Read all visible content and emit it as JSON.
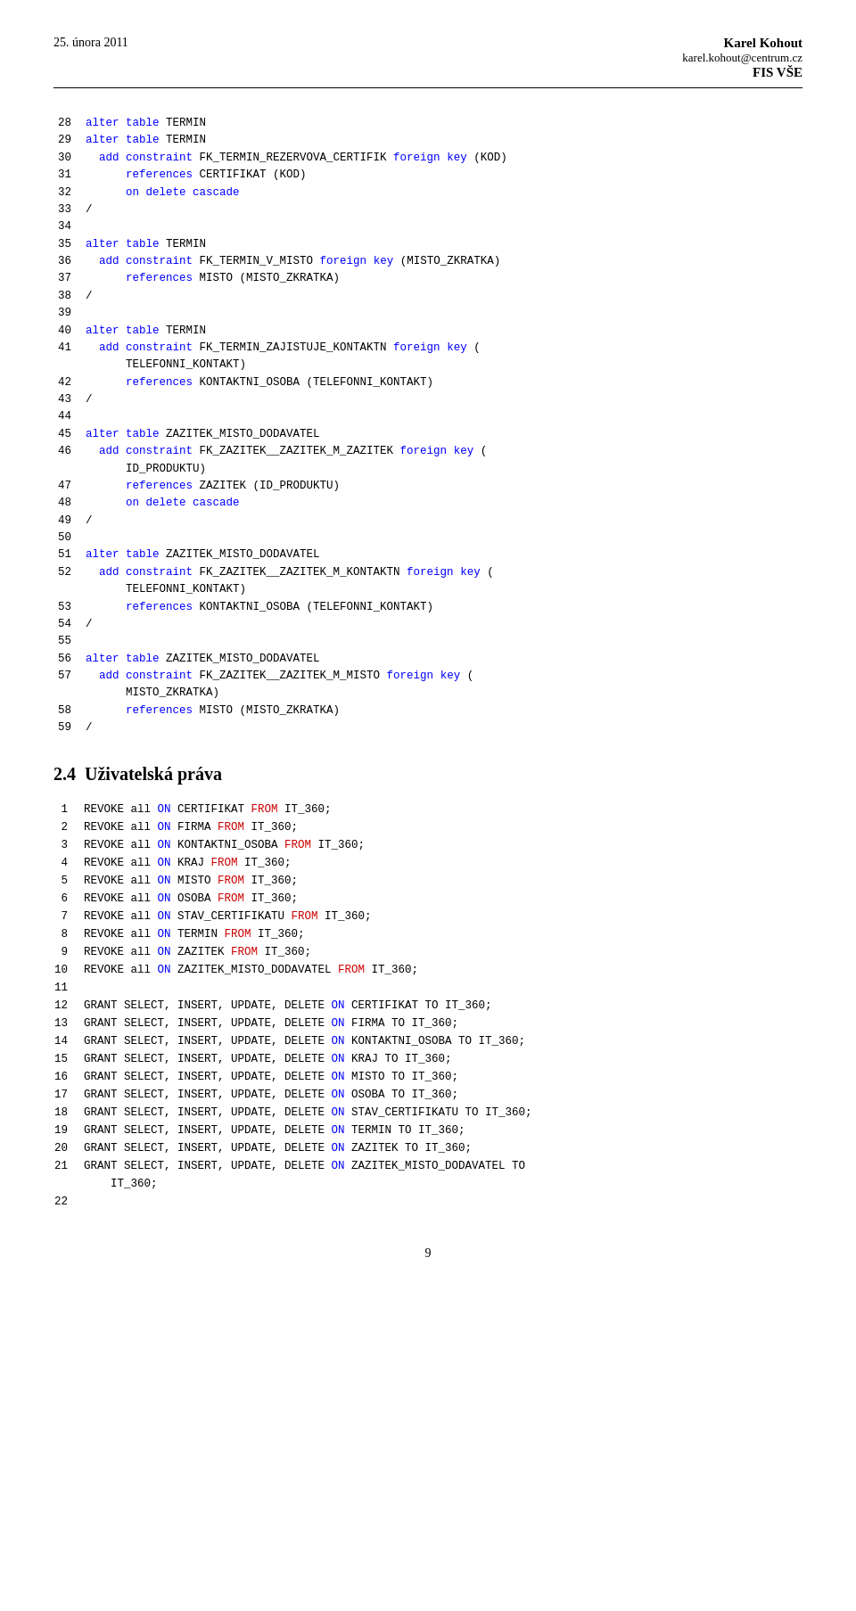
{
  "header": {
    "date": "25. února 2011",
    "name": "Karel Kohout",
    "email": "karel.kohout@centrum.cz",
    "course": "FIS VŠE"
  },
  "section_heading": "2.4",
  "section_title": "Uživatelská práva",
  "footer_page": "9",
  "code_lines": [
    {
      "num": 28,
      "text": "alter table TERMIN"
    },
    {
      "num": 29,
      "text": "alter table TERMIN"
    },
    {
      "num": 30,
      "text": "  add constraint FK_TERMIN_REZERVOVA_CERTIFIK foreign key (KOD)"
    },
    {
      "num": 31,
      "text": "      references CERTIFIKAT (KOD)"
    },
    {
      "num": 32,
      "text": "      on delete cascade"
    },
    {
      "num": 33,
      "text": "/"
    },
    {
      "num": 34,
      "text": ""
    },
    {
      "num": 35,
      "text": "alter table TERMIN"
    },
    {
      "num": 36,
      "text": "  add constraint FK_TERMIN_V_MISTO foreign key (MISTO_ZKRATKA)"
    },
    {
      "num": 37,
      "text": "      references MISTO (MISTO_ZKRATKA)"
    },
    {
      "num": 38,
      "text": "/"
    },
    {
      "num": 39,
      "text": ""
    },
    {
      "num": 40,
      "text": "alter table TERMIN"
    },
    {
      "num": 41,
      "text": "  add constraint FK_TERMIN_ZAJISTUJE_KONTAKTN foreign key ("
    },
    {
      "num": "",
      "text": "      TELEFONNI_KONTAKT)"
    },
    {
      "num": 42,
      "text": "      references KONTAKTNI_OSOBA (TELEFONNI_KONTAKT)"
    },
    {
      "num": 43,
      "text": "/"
    },
    {
      "num": 44,
      "text": ""
    },
    {
      "num": 45,
      "text": "alter table ZAZITEK_MISTO_DODAVATEL"
    },
    {
      "num": 46,
      "text": "  add constraint FK_ZAZITEK__ZAZITEK_M_ZAZITEK foreign key ("
    },
    {
      "num": "",
      "text": "      ID_PRODUKTU)"
    },
    {
      "num": 47,
      "text": "      references ZAZITEK (ID_PRODUKTU)"
    },
    {
      "num": 48,
      "text": "      on delete cascade"
    },
    {
      "num": 49,
      "text": "/"
    },
    {
      "num": 50,
      "text": ""
    },
    {
      "num": 51,
      "text": "alter table ZAZITEK_MISTO_DODAVATEL"
    },
    {
      "num": 52,
      "text": "  add constraint FK_ZAZITEK__ZAZITEK_M_KONTAKTN foreign key ("
    },
    {
      "num": "",
      "text": "      TELEFONNI_KONTAKT)"
    },
    {
      "num": 53,
      "text": "      references KONTAKTNI_OSOBA (TELEFONNI_KONTAKT)"
    },
    {
      "num": 54,
      "text": "/"
    },
    {
      "num": 55,
      "text": ""
    },
    {
      "num": 56,
      "text": "alter table ZAZITEK_MISTO_DODAVATEL"
    },
    {
      "num": 57,
      "text": "  add constraint FK_ZAZITEK__ZAZITEK_M_MISTO foreign key ("
    },
    {
      "num": "",
      "text": "      MISTO_ZKRATKA)"
    },
    {
      "num": 58,
      "text": "      references MISTO (MISTO_ZKRATKA)"
    },
    {
      "num": 59,
      "text": "/"
    }
  ],
  "sql_lines": [
    {
      "num": 1,
      "parts": [
        {
          "t": "REVOKE",
          "c": "plain"
        },
        {
          "t": " all ",
          "c": "plain"
        },
        {
          "t": "ON",
          "c": "blue"
        },
        {
          "t": " CERTIFIKAT ",
          "c": "plain"
        },
        {
          "t": "FROM",
          "c": "red"
        },
        {
          "t": " IT_360;",
          "c": "plain"
        }
      ]
    },
    {
      "num": 2,
      "parts": [
        {
          "t": "REVOKE",
          "c": "plain"
        },
        {
          "t": " all ",
          "c": "plain"
        },
        {
          "t": "ON",
          "c": "blue"
        },
        {
          "t": " FIRMA ",
          "c": "plain"
        },
        {
          "t": "FROM",
          "c": "red"
        },
        {
          "t": " IT_360;",
          "c": "plain"
        }
      ]
    },
    {
      "num": 3,
      "parts": [
        {
          "t": "REVOKE",
          "c": "plain"
        },
        {
          "t": " all ",
          "c": "plain"
        },
        {
          "t": "ON",
          "c": "blue"
        },
        {
          "t": " KONTAKTNI_OSOBA ",
          "c": "plain"
        },
        {
          "t": "FROM",
          "c": "red"
        },
        {
          "t": " IT_360;",
          "c": "plain"
        }
      ]
    },
    {
      "num": 4,
      "parts": [
        {
          "t": "REVOKE",
          "c": "plain"
        },
        {
          "t": " all ",
          "c": "plain"
        },
        {
          "t": "ON",
          "c": "blue"
        },
        {
          "t": " KRAJ ",
          "c": "plain"
        },
        {
          "t": "FROM",
          "c": "red"
        },
        {
          "t": " IT_360;",
          "c": "plain"
        }
      ]
    },
    {
      "num": 5,
      "parts": [
        {
          "t": "REVOKE",
          "c": "plain"
        },
        {
          "t": " all ",
          "c": "plain"
        },
        {
          "t": "ON",
          "c": "blue"
        },
        {
          "t": " MISTO ",
          "c": "plain"
        },
        {
          "t": "FROM",
          "c": "red"
        },
        {
          "t": " IT_360;",
          "c": "plain"
        }
      ]
    },
    {
      "num": 6,
      "parts": [
        {
          "t": "REVOKE",
          "c": "plain"
        },
        {
          "t": " all ",
          "c": "plain"
        },
        {
          "t": "ON",
          "c": "blue"
        },
        {
          "t": " OSOBA ",
          "c": "plain"
        },
        {
          "t": "FROM",
          "c": "red"
        },
        {
          "t": " IT_360;",
          "c": "plain"
        }
      ]
    },
    {
      "num": 7,
      "parts": [
        {
          "t": "REVOKE",
          "c": "plain"
        },
        {
          "t": " all ",
          "c": "plain"
        },
        {
          "t": "ON",
          "c": "blue"
        },
        {
          "t": " STAV_CERTIFIKATU ",
          "c": "plain"
        },
        {
          "t": "FROM",
          "c": "red"
        },
        {
          "t": " IT_360;",
          "c": "plain"
        }
      ]
    },
    {
      "num": 8,
      "parts": [
        {
          "t": "REVOKE",
          "c": "plain"
        },
        {
          "t": " all ",
          "c": "plain"
        },
        {
          "t": "ON",
          "c": "blue"
        },
        {
          "t": " TERMIN ",
          "c": "plain"
        },
        {
          "t": "FROM",
          "c": "red"
        },
        {
          "t": " IT_360;",
          "c": "plain"
        }
      ]
    },
    {
      "num": 9,
      "parts": [
        {
          "t": "REVOKE",
          "c": "plain"
        },
        {
          "t": " all ",
          "c": "plain"
        },
        {
          "t": "ON",
          "c": "blue"
        },
        {
          "t": " ZAZITEK ",
          "c": "plain"
        },
        {
          "t": "FROM",
          "c": "red"
        },
        {
          "t": " IT_360;",
          "c": "plain"
        }
      ]
    },
    {
      "num": 10,
      "parts": [
        {
          "t": "REVOKE",
          "c": "plain"
        },
        {
          "t": " all ",
          "c": "plain"
        },
        {
          "t": "ON",
          "c": "blue"
        },
        {
          "t": " ZAZITEK_MISTO_DODAVATEL ",
          "c": "plain"
        },
        {
          "t": "FROM",
          "c": "red"
        },
        {
          "t": " IT_360;",
          "c": "plain"
        }
      ]
    },
    {
      "num": 11,
      "parts": [
        {
          "t": "",
          "c": "plain"
        }
      ]
    },
    {
      "num": 12,
      "parts": [
        {
          "t": "GRANT SELECT, INSERT, UPDATE, DELETE ",
          "c": "plain"
        },
        {
          "t": "ON",
          "c": "blue"
        },
        {
          "t": " CERTIFIKAT TO IT_360;",
          "c": "plain"
        }
      ]
    },
    {
      "num": 13,
      "parts": [
        {
          "t": "GRANT SELECT, INSERT, UPDATE, DELETE ",
          "c": "plain"
        },
        {
          "t": "ON",
          "c": "blue"
        },
        {
          "t": " FIRMA TO IT_360;",
          "c": "plain"
        }
      ]
    },
    {
      "num": 14,
      "parts": [
        {
          "t": "GRANT SELECT, INSERT, UPDATE, DELETE ",
          "c": "plain"
        },
        {
          "t": "ON",
          "c": "blue"
        },
        {
          "t": " KONTAKTNI_OSOBA TO IT_360;",
          "c": "plain"
        }
      ]
    },
    {
      "num": 15,
      "parts": [
        {
          "t": "GRANT SELECT, INSERT, UPDATE, DELETE ",
          "c": "plain"
        },
        {
          "t": "ON",
          "c": "blue"
        },
        {
          "t": " KRAJ TO IT_360;",
          "c": "plain"
        }
      ]
    },
    {
      "num": 16,
      "parts": [
        {
          "t": "GRANT SELECT, INSERT, UPDATE, DELETE ",
          "c": "plain"
        },
        {
          "t": "ON",
          "c": "blue"
        },
        {
          "t": " MISTO TO IT_360;",
          "c": "plain"
        }
      ]
    },
    {
      "num": 17,
      "parts": [
        {
          "t": "GRANT SELECT, INSERT, UPDATE, DELETE ",
          "c": "plain"
        },
        {
          "t": "ON",
          "c": "blue"
        },
        {
          "t": " OSOBA TO IT_360;",
          "c": "plain"
        }
      ]
    },
    {
      "num": 18,
      "parts": [
        {
          "t": "GRANT SELECT, INSERT, UPDATE, DELETE ",
          "c": "plain"
        },
        {
          "t": "ON",
          "c": "blue"
        },
        {
          "t": " STAV_CERTIFIKATU TO IT_360;",
          "c": "plain"
        }
      ]
    },
    {
      "num": 19,
      "parts": [
        {
          "t": "GRANT SELECT, INSERT, UPDATE, DELETE ",
          "c": "plain"
        },
        {
          "t": "ON",
          "c": "blue"
        },
        {
          "t": " TERMIN TO IT_360;",
          "c": "plain"
        }
      ]
    },
    {
      "num": 20,
      "parts": [
        {
          "t": "GRANT SELECT, INSERT, UPDATE, DELETE ",
          "c": "plain"
        },
        {
          "t": "ON",
          "c": "blue"
        },
        {
          "t": " ZAZITEK TO IT_360;",
          "c": "plain"
        }
      ]
    },
    {
      "num": 21,
      "parts": [
        {
          "t": "GRANT SELECT, INSERT, UPDATE, DELETE ",
          "c": "plain"
        },
        {
          "t": "ON",
          "c": "blue"
        },
        {
          "t": " ZAZITEK_MISTO_DODAVATEL TO",
          "c": "plain"
        }
      ]
    },
    {
      "num": "",
      "parts": [
        {
          "t": "    IT_360;",
          "c": "plain"
        }
      ]
    },
    {
      "num": 22,
      "parts": [
        {
          "t": "",
          "c": "plain"
        }
      ]
    }
  ]
}
